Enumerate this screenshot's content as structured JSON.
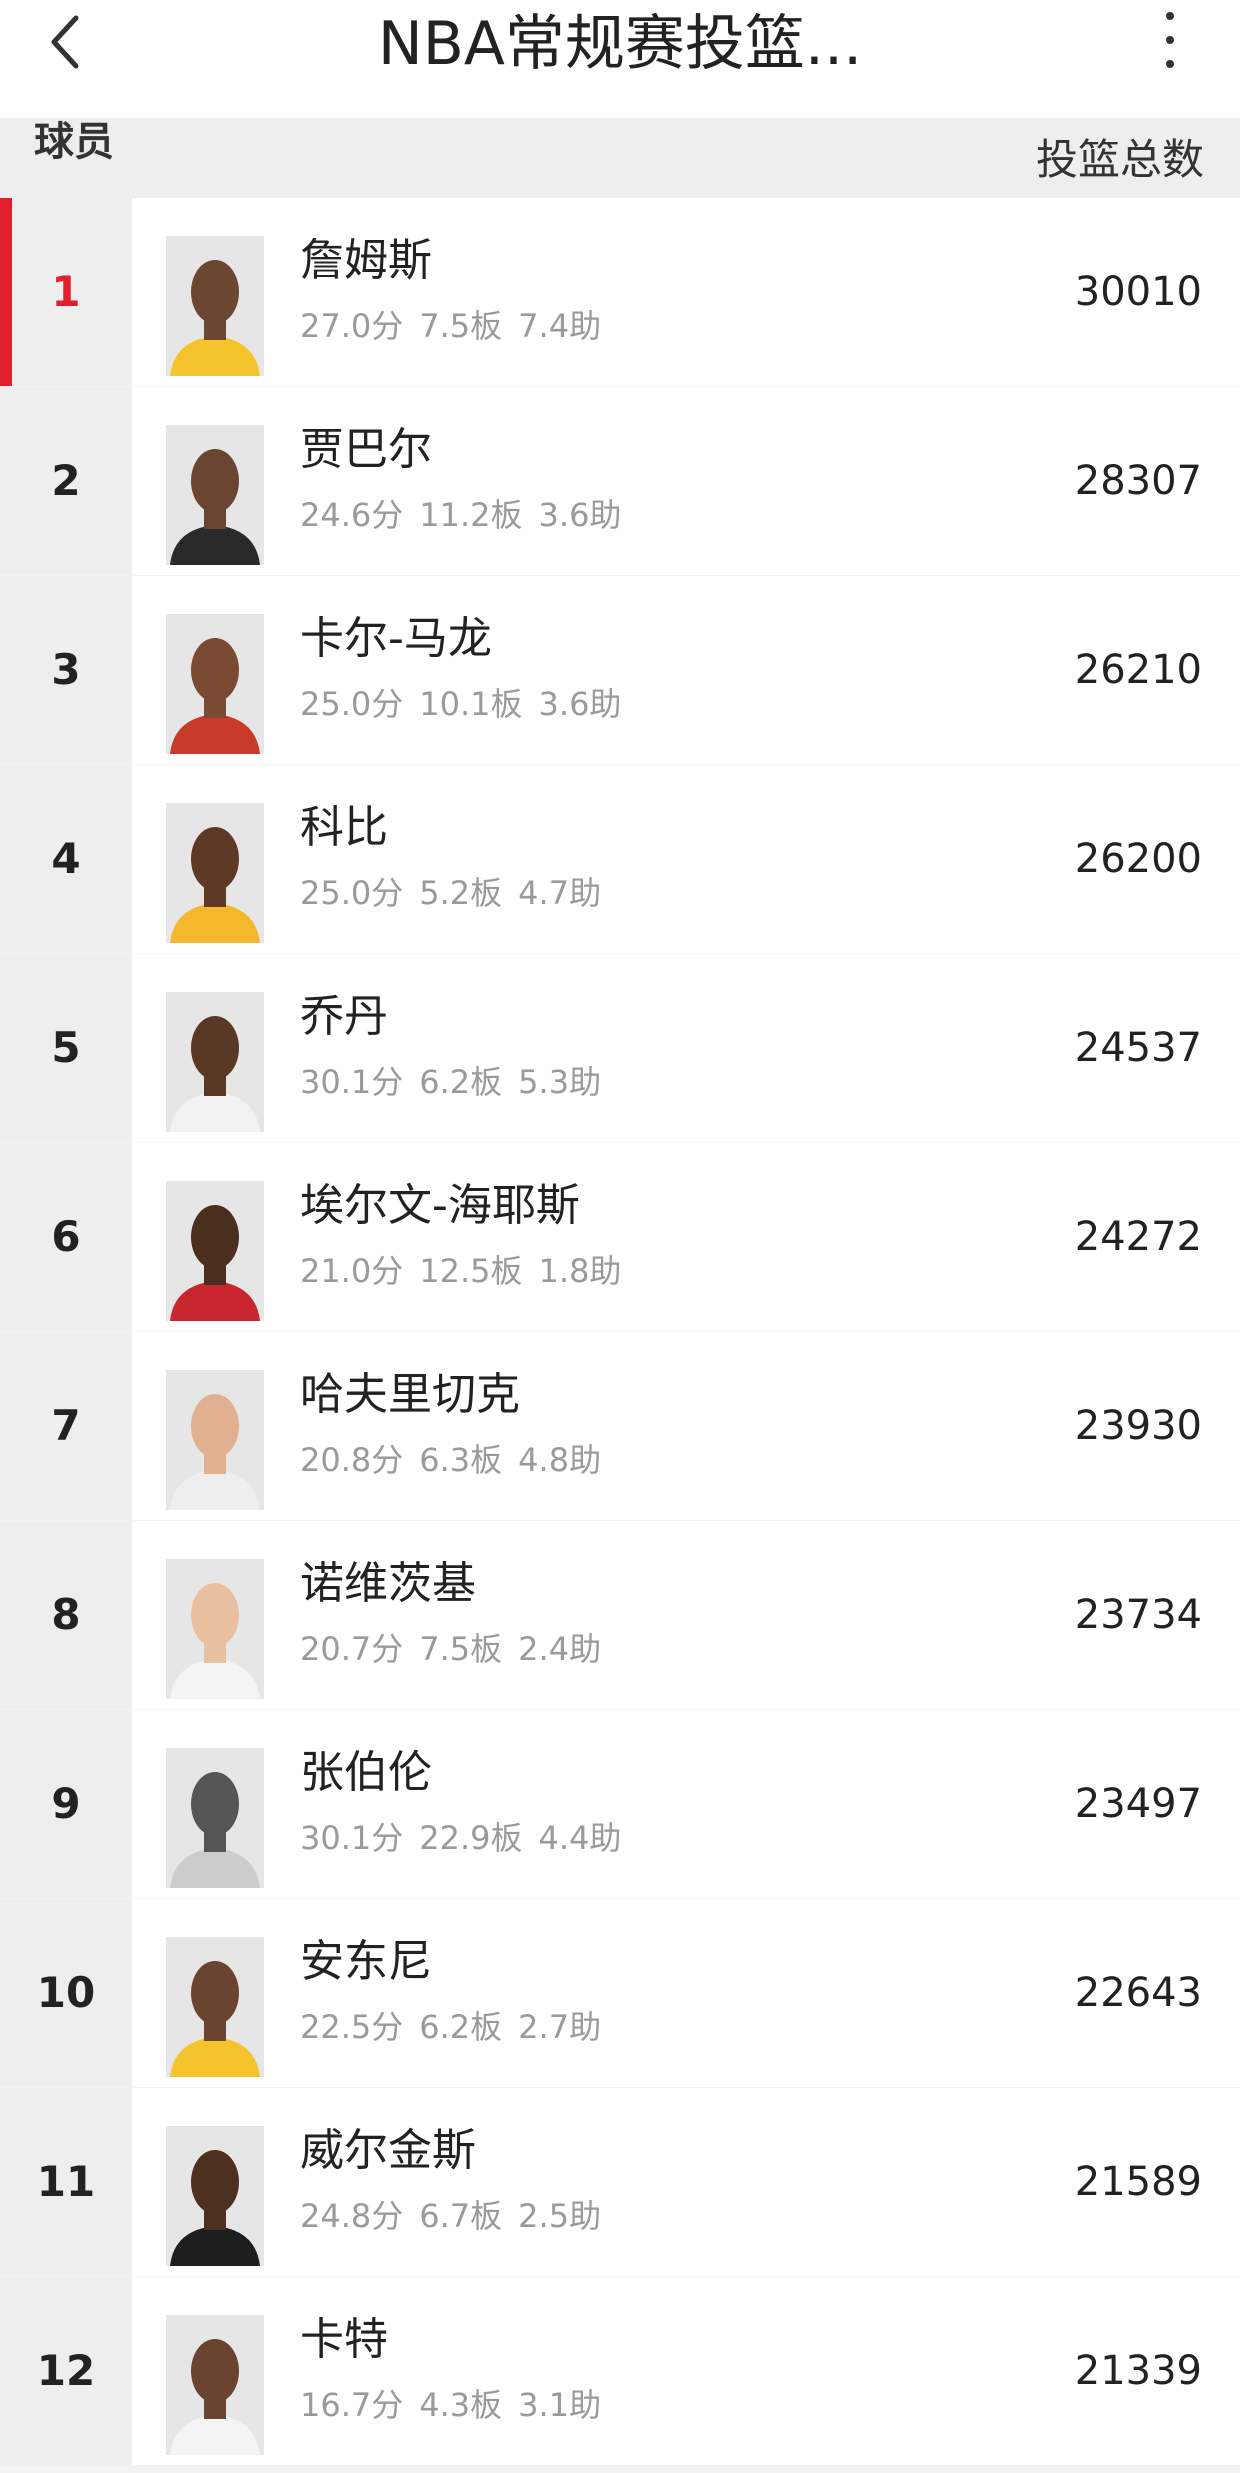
{
  "app": {
    "title": "NBA常规赛投篮...",
    "back_icon": "back-arrow-icon",
    "more_icon": "more-vertical-icon"
  },
  "header": {
    "player_label": "球员",
    "total_label": "投篮总数"
  },
  "colors": {
    "accent": "#e01e2e",
    "secondary_text": "#9a9a9a"
  },
  "players": [
    {
      "rank": "1",
      "name": "詹姆斯",
      "pts": "27.0分",
      "reb": "7.5板",
      "ast": "7.4助",
      "total": "30010",
      "skin": "#6b4630",
      "jersey": "#f5c42c"
    },
    {
      "rank": "2",
      "name": "贾巴尔",
      "pts": "24.6分",
      "reb": "11.2板",
      "ast": "3.6助",
      "total": "28307",
      "skin": "#6a4532",
      "jersey": "#2a2a2a"
    },
    {
      "rank": "3",
      "name": "卡尔-马龙",
      "pts": "25.0分",
      "reb": "10.1板",
      "ast": "3.6助",
      "total": "26210",
      "skin": "#7a4a32",
      "jersey": "#c83a2a"
    },
    {
      "rank": "4",
      "name": "科比",
      "pts": "25.0分",
      "reb": "5.2板",
      "ast": "4.7助",
      "total": "26200",
      "skin": "#5e3a26",
      "jersey": "#f5b82c"
    },
    {
      "rank": "5",
      "name": "乔丹",
      "pts": "30.1分",
      "reb": "6.2板",
      "ast": "5.3助",
      "total": "24537",
      "skin": "#5a3826",
      "jersey": "#f2f2f2"
    },
    {
      "rank": "6",
      "name": "埃尔文-海耶斯",
      "pts": "21.0分",
      "reb": "12.5板",
      "ast": "1.8助",
      "total": "24272",
      "skin": "#4a2e1e",
      "jersey": "#c8262e"
    },
    {
      "rank": "7",
      "name": "哈夫里切克",
      "pts": "20.8分",
      "reb": "6.3板",
      "ast": "4.8助",
      "total": "23930",
      "skin": "#e0b090",
      "jersey": "#eeeeee"
    },
    {
      "rank": "8",
      "name": "诺维茨基",
      "pts": "20.7分",
      "reb": "7.5板",
      "ast": "2.4助",
      "total": "23734",
      "skin": "#e8c0a0",
      "jersey": "#f4f4f4"
    },
    {
      "rank": "9",
      "name": "张伯伦",
      "pts": "30.1分",
      "reb": "22.9板",
      "ast": "4.4助",
      "total": "23497",
      "skin": "#555555",
      "jersey": "#cccccc"
    },
    {
      "rank": "10",
      "name": "安东尼",
      "pts": "22.5分",
      "reb": "6.2板",
      "ast": "2.7助",
      "total": "22643",
      "skin": "#6a4430",
      "jersey": "#f5c42c"
    },
    {
      "rank": "11",
      "name": "威尔金斯",
      "pts": "24.8分",
      "reb": "6.7板",
      "ast": "2.5助",
      "total": "21589",
      "skin": "#4e3020",
      "jersey": "#1e1e1e"
    },
    {
      "rank": "12",
      "name": "卡特",
      "pts": "16.7分",
      "reb": "4.3板",
      "ast": "3.1助",
      "total": "21339",
      "skin": "#6a4430",
      "jersey": "#f4f4f4"
    }
  ]
}
